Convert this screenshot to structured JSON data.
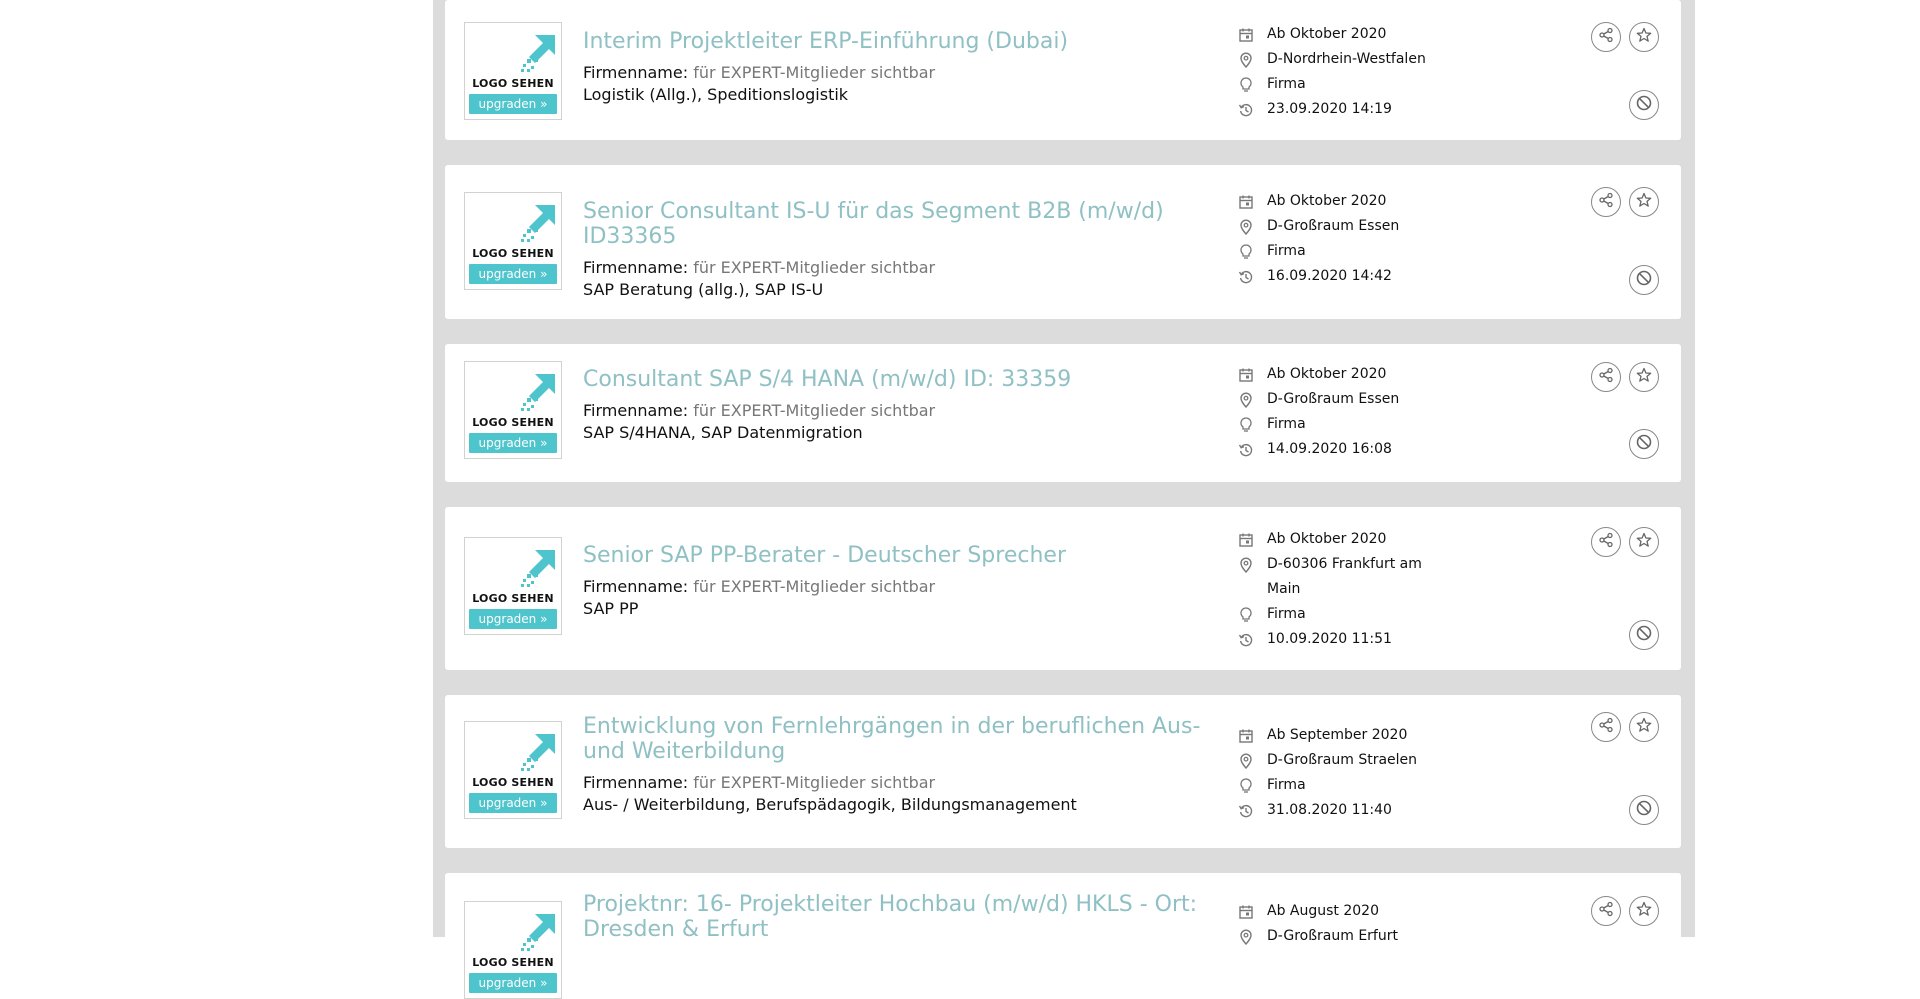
{
  "logo": {
    "text": "LOGO SEHEN",
    "button": "upgraden »"
  },
  "company_label": "Firmenname:",
  "jobs": [
    {
      "title": "Interim Projektleiter ERP-Einführung (Dubai)",
      "company_value": "für EXPERT-Mitglieder sichtbar",
      "skills": "Logistik (Allg.), Speditionslogistik",
      "start": "Ab Oktober 2020",
      "location": "D-Nordrhein-Westfalen",
      "type": "Firma",
      "date": "23.09.2020 14:19"
    },
    {
      "title": "Senior Consultant IS-U für das Segment B2B (m/w/d) ID33365",
      "company_value": "für EXPERT-Mitglieder sichtbar",
      "skills": "SAP Beratung (allg.), SAP IS-U",
      "start": "Ab Oktober 2020",
      "location": "D-Großraum Essen",
      "type": "Firma",
      "date": "16.09.2020 14:42"
    },
    {
      "title": "Consultant SAP S/4 HANA (m/w/d) ID: 33359",
      "company_value": "für EXPERT-Mitglieder sichtbar",
      "skills": "SAP S/4HANA, SAP Datenmigration",
      "start": "Ab Oktober 2020",
      "location": "D-Großraum Essen",
      "type": "Firma",
      "date": "14.09.2020 16:08"
    },
    {
      "title": "Senior SAP PP-Berater - Deutscher Sprecher",
      "company_value": "für EXPERT-Mitglieder sichtbar",
      "skills": "SAP PP",
      "start": "Ab Oktober 2020",
      "location": "D-60306 Frankfurt am Main",
      "type": "Firma",
      "date": "10.09.2020 11:51"
    },
    {
      "title": "Entwicklung von Fernlehrgängen in der beruflichen Aus- und Weiterbildung",
      "company_value": "für EXPERT-Mitglieder sichtbar",
      "skills": "Aus- / Weiterbildung, Berufspädagogik, Bildungsmanagement",
      "start": "Ab September 2020",
      "location": "D-Großraum Straelen",
      "type": "Firma",
      "date": "31.08.2020 11:40"
    },
    {
      "title": "Projektnr: 16- Projektleiter Hochbau (m/w/d) HKLS - Ort: Dresden & Erfurt",
      "company_value": "",
      "skills": "",
      "start": "Ab August 2020",
      "location": "D-Großraum Erfurt",
      "type": "",
      "date": ""
    }
  ],
  "icons": {
    "calendar": "calendar-icon",
    "location": "location-pin-icon",
    "type": "lightbulb-icon",
    "date": "history-icon",
    "share": "share-icon",
    "favorite": "star-icon",
    "hide": "block-icon"
  },
  "colors": {
    "title": "#8fc0c4",
    "upgrade_button": "#4ec4cc",
    "background": "#dcdcdc"
  }
}
